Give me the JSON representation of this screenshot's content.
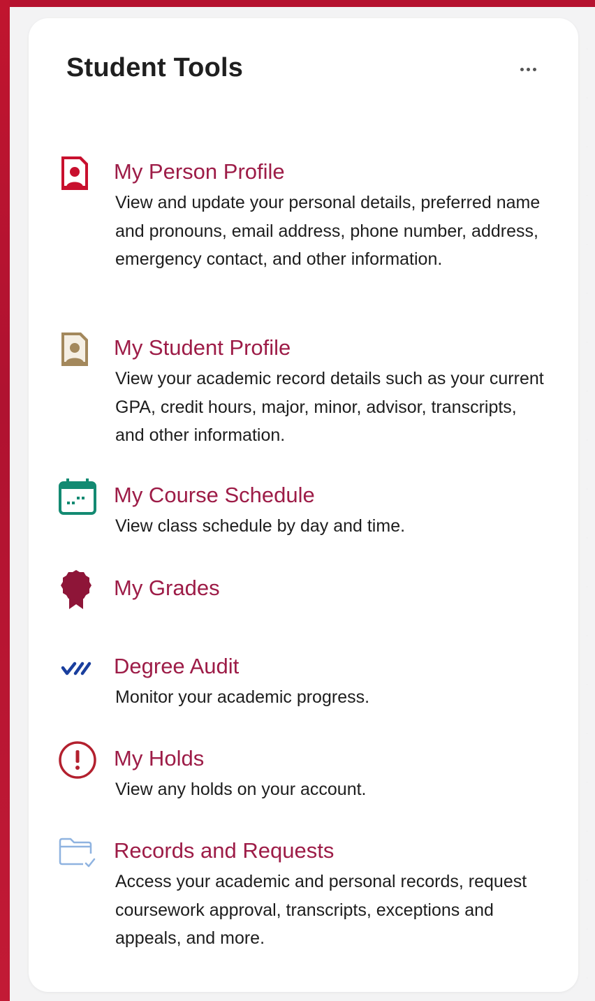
{
  "widget": {
    "title": "Student Tools",
    "more_icon": "more-horizontal-icon"
  },
  "tools": [
    {
      "title": "My Person Profile",
      "description": "View and update your personal details, preferred name and pronouns, email address, phone number, address, emergency contact, and other information.",
      "icon": "person-profile-icon",
      "icon_color": "#c8102e"
    },
    {
      "title": "My Student Profile",
      "description": "View your academic record details such as your current GPA, credit hours, major, minor, advisor, transcripts, and other information.",
      "icon": "student-profile-icon",
      "icon_color": "#a3885c"
    },
    {
      "title": "My Course Schedule",
      "description": "View class schedule by day and time.",
      "icon": "calendar-icon",
      "icon_color": "#138a72"
    },
    {
      "title": "My Grades",
      "description": "",
      "icon": "award-ribbon-icon",
      "icon_color": "#8e1538"
    },
    {
      "title": "Degree Audit",
      "description": "Monitor your academic progress.",
      "icon": "double-check-icon",
      "icon_color": "#1a3f9e"
    },
    {
      "title": "My Holds",
      "description": "View any holds on your account.",
      "icon": "alert-circle-icon",
      "icon_color": "#b3202e"
    },
    {
      "title": "Records and Requests",
      "description": "Access your academic and personal records, request coursework approval, transcripts, exceptions and appeals, and more.",
      "icon": "folder-check-icon",
      "icon_color": "#8fb3e0"
    }
  ],
  "colors": {
    "accent_red": "#b5122f",
    "link_color": "#9d1c47",
    "text_color": "#1d1d1d"
  }
}
